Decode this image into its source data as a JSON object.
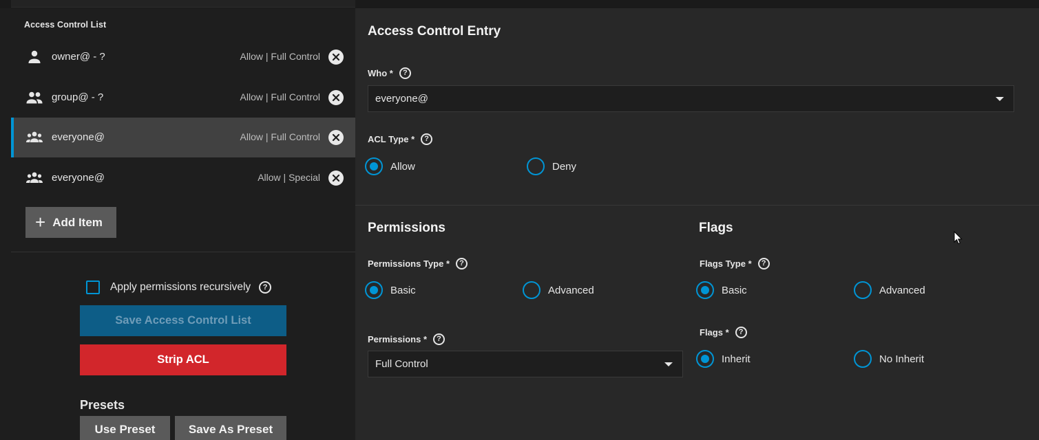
{
  "acl_list": {
    "title": "Access Control List",
    "items": [
      {
        "name": "owner@ - ?",
        "perm": "Allow | Full Control",
        "icon": "user-icon"
      },
      {
        "name": "group@ - ?",
        "perm": "Allow | Full Control",
        "icon": "group-icon"
      },
      {
        "name": "everyone@",
        "perm": "Allow | Full Control",
        "icon": "everyone-icon",
        "selected": true
      },
      {
        "name": "everyone@",
        "perm": "Allow | Special",
        "icon": "everyone-icon"
      }
    ],
    "add_label": "Add Item"
  },
  "actions": {
    "recursive_label": "Apply permissions recursively",
    "recursive_checked": false,
    "save_label": "Save Access Control List",
    "strip_label": "Strip ACL",
    "presets_title": "Presets",
    "use_preset_label": "Use Preset",
    "save_preset_label": "Save As Preset"
  },
  "entry": {
    "title": "Access Control Entry",
    "who_label": "Who",
    "who_value": "everyone@",
    "acl_type_label": "ACL Type",
    "acl_type_options": [
      "Allow",
      "Deny"
    ],
    "acl_type_selected": "Allow"
  },
  "permissions": {
    "title": "Permissions",
    "type_label": "Permissions Type",
    "type_options": [
      "Basic",
      "Advanced"
    ],
    "type_selected": "Basic",
    "perm_label": "Permissions",
    "perm_value": "Full Control"
  },
  "flags": {
    "title": "Flags",
    "type_label": "Flags Type",
    "type_options": [
      "Basic",
      "Advanced"
    ],
    "type_selected": "Basic",
    "flags_label": "Flags",
    "flags_options": [
      "Inherit",
      "No Inherit"
    ],
    "flags_selected": "Inherit"
  },
  "required_marker": "*",
  "help_glyph": "?",
  "colors": {
    "accent": "#0095d5",
    "danger": "#d2262b",
    "primary_disabled": "#0d5d87"
  }
}
